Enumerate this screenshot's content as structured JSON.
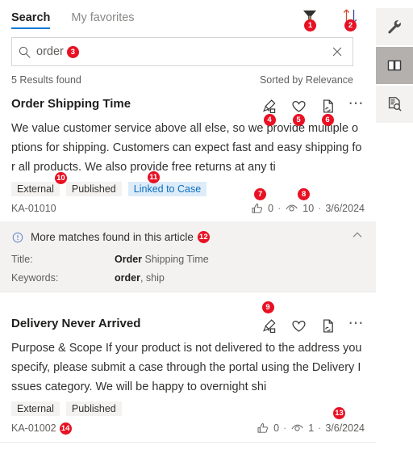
{
  "tabs": [
    {
      "label": "Search",
      "active": true
    },
    {
      "label": "My favorites",
      "active": false
    }
  ],
  "toolbar": {
    "filter_icon": "filter-icon",
    "filter_badge": "1",
    "sort_icon": "sort-ascending-descending-icon",
    "sort_badge": "2"
  },
  "search": {
    "value": "order",
    "placeholder": "Search",
    "badge": "3",
    "search_icon": "search-icon",
    "clear_icon": "close-icon"
  },
  "results_meta": {
    "count_text": "5 Results found",
    "sort_text": "Sorted by Relevance"
  },
  "articles": [
    {
      "title": "Order Shipping Time",
      "snippet": "We value customer service above all else, so we provide multiple options for shipping. Customers can expect fast and easy shipping for all products. We also provide free returns at any ti",
      "tags": [
        {
          "label": "External",
          "style": "gray",
          "badge": "10"
        },
        {
          "label": "Published",
          "style": "gray",
          "badge": null
        },
        {
          "label": "Linked to Case",
          "style": "blue",
          "badge": "11"
        }
      ],
      "article_number": "KA-01010",
      "article_number_badge": null,
      "likes": "0",
      "views": "10",
      "date": "3/6/2024",
      "likes_badge": "7",
      "views_badge": "8",
      "date_badge": null,
      "icons": [
        {
          "name": "link-to-case-icon",
          "badge": "4"
        },
        {
          "name": "favorite-heart-icon",
          "badge": "5"
        },
        {
          "name": "copy-link-icon",
          "badge": "6"
        },
        {
          "name": "more-options-icon",
          "badge": null
        }
      ],
      "more_matches": {
        "title": "More matches found in this article",
        "badge": "12",
        "info_icon": "info-circle-icon",
        "chevron_icon": "chevron-up-icon",
        "rows": [
          {
            "key": "Title:",
            "match": "Order",
            "rest": " Shipping Time"
          },
          {
            "key": "Keywords:",
            "match": "order",
            "rest": ", ship"
          }
        ]
      }
    },
    {
      "title": "Delivery Never Arrived",
      "snippet": "Purpose & Scope If your product is not delivered to the address you specify, please submit a case through the portal using the Delivery Issues category. We will be happy to overnight shi",
      "tags": [
        {
          "label": "External",
          "style": "gray",
          "badge": null
        },
        {
          "label": "Published",
          "style": "gray",
          "badge": null
        }
      ],
      "article_number": "KA-01002",
      "article_number_badge": "14",
      "likes": "0",
      "views": "1",
      "date": "3/6/2024",
      "likes_badge": null,
      "views_badge": null,
      "date_badge": "13",
      "icons": [
        {
          "name": "link-to-case-icon",
          "badge": "9"
        },
        {
          "name": "favorite-heart-icon",
          "badge": null
        },
        {
          "name": "copy-link-icon",
          "badge": null
        },
        {
          "name": "more-options-icon",
          "badge": null
        }
      ],
      "more_matches": null
    }
  ],
  "rail": {
    "items": [
      {
        "name": "tools-wrench-icon",
        "selected": false
      },
      {
        "name": "knowledge-base-book-icon",
        "selected": true
      },
      {
        "name": "document-search-icon",
        "selected": false
      }
    ]
  },
  "colors": {
    "accent": "#0078d4",
    "badge_red": "#e81123",
    "tag_gray": "#f3f2f1",
    "tag_blue": "#deecf9",
    "rail_selected": "#b3b0ad"
  }
}
